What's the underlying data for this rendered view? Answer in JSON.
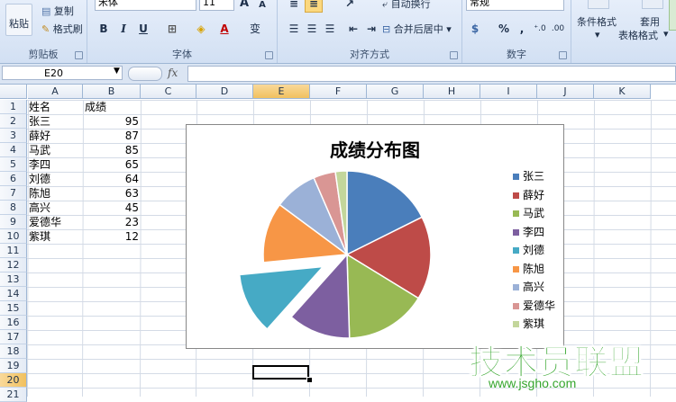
{
  "ribbon": {
    "clipboard": {
      "label": "剪贴板",
      "paste": "粘贴",
      "copy": "复制",
      "format_painter": "格式刷"
    },
    "font": {
      "label": "字体",
      "font_name": "宋体",
      "font_size": "11",
      "bold": "B",
      "italic": "I",
      "underline": "U",
      "grow": "A",
      "shrink": "A",
      "phonetic": "变"
    },
    "alignment": {
      "label": "对齐方式",
      "wrap": "自动换行",
      "merge": "合并后居中"
    },
    "number": {
      "label": "数字",
      "format": "常规",
      "percent": "%",
      "comma": ",",
      "inc_decimal": "⁺.0",
      "dec_decimal": ".00"
    },
    "styles": {
      "conditional": "条件格式",
      "table_format_1": "套用",
      "table_format_2": "表格格式"
    }
  },
  "formula_bar": {
    "name_box": "E20",
    "fx": "fx",
    "content": ""
  },
  "columns": [
    "A",
    "B",
    "C",
    "D",
    "E",
    "F",
    "G",
    "H",
    "I",
    "J",
    "K"
  ],
  "rows": [
    "1",
    "2",
    "3",
    "4",
    "5",
    "6",
    "7",
    "8",
    "9",
    "10",
    "11",
    "12",
    "13",
    "14",
    "15",
    "16",
    "17",
    "18",
    "19",
    "20",
    "21"
  ],
  "selected_cell": "E20",
  "sheet": {
    "header": {
      "name": "姓名",
      "score": "成绩"
    },
    "records": [
      {
        "name": "张三",
        "score": "95"
      },
      {
        "name": "薛好",
        "score": "87"
      },
      {
        "name": "马武",
        "score": "85"
      },
      {
        "name": "李四",
        "score": "65"
      },
      {
        "name": "刘德",
        "score": "64"
      },
      {
        "name": "陈旭",
        "score": "63"
      },
      {
        "name": "高兴",
        "score": "45"
      },
      {
        "name": "爱德华",
        "score": "23"
      },
      {
        "name": "紫琪",
        "score": "12"
      }
    ]
  },
  "chart_data": {
    "type": "pie",
    "title": "成绩分布图",
    "categories": [
      "张三",
      "薛好",
      "马武",
      "李四",
      "刘德",
      "陈旭",
      "高兴",
      "爱德华",
      "紫琪"
    ],
    "values": [
      95,
      87,
      85,
      65,
      64,
      63,
      45,
      23,
      12
    ],
    "colors": [
      "#4a7ebb",
      "#be4b48",
      "#98b954",
      "#7d5fa0",
      "#46aac5",
      "#f79646",
      "#9bb1d7",
      "#d99694",
      "#c3d69b"
    ],
    "exploded_slice": "刘德",
    "legend_position": "right"
  },
  "watermark": {
    "text": "技术员联盟",
    "url": "www.jsgho.com"
  }
}
